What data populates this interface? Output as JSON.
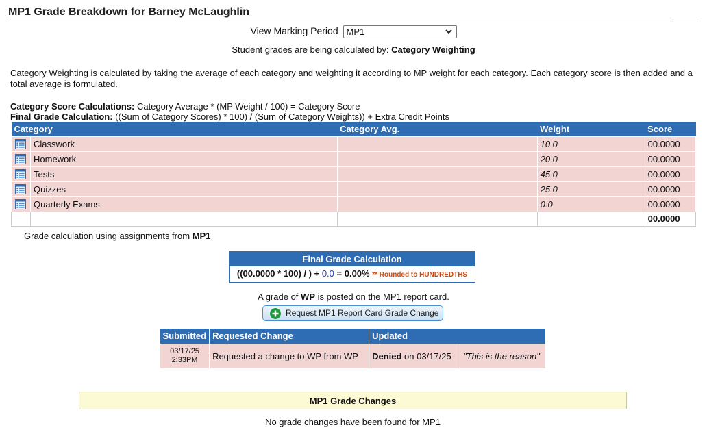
{
  "page": {
    "title": "MP1 Grade Breakdown for Barney McLaughlin"
  },
  "marking_period": {
    "label": "View Marking Period",
    "selected": "MP1"
  },
  "calc_method": {
    "prefix": "Student grades are being calculated by:",
    "method": "Category Weighting"
  },
  "description": "Category Weighting is calculated by taking the average of each category and weighting it according to MP weight for each category. Each category score is then added and a total average is formulated.",
  "formulas": {
    "category_label": "Category Score Calculations:",
    "category_text": "Category Average * (MP Weight / 100) = Category Score",
    "final_label": "Final Grade Calculation:",
    "final_text": "((Sum of Category Scores) * 100) / (Sum of Category Weights)) + Extra Credit Points"
  },
  "category_table": {
    "headers": {
      "category": "Category",
      "avg": "Category Avg.",
      "weight": "Weight",
      "score": "Score"
    },
    "rows": [
      {
        "category": "Classwork",
        "avg": "",
        "weight": "10.0",
        "score": "00.0000",
        "icon": "list-icon"
      },
      {
        "category": "Homework",
        "avg": "",
        "weight": "20.0",
        "score": "00.0000",
        "icon": "list-icon"
      },
      {
        "category": "Tests",
        "avg": "",
        "weight": "45.0",
        "score": "00.0000",
        "icon": "list-icon"
      },
      {
        "category": "Quizzes",
        "avg": "",
        "weight": "25.0",
        "score": "00.0000",
        "icon": "list-icon"
      },
      {
        "category": "Quarterly Exams",
        "avg": "",
        "weight": "0.0",
        "score": "00.0000",
        "icon": "list-icon"
      }
    ],
    "total_score": "00.0000"
  },
  "grade_using": {
    "prefix": "Grade calculation using assignments from",
    "mp": "MP1"
  },
  "final_calc": {
    "header": "Final Grade Calculation",
    "expr_start": "((00.0000 * 100) / ) + ",
    "extra": "0.0",
    "expr_end": " = 0.00%",
    "rounding": "** Rounded to HUNDREDTHS"
  },
  "posted": {
    "prefix": "A grade of",
    "grade": "WP",
    "suffix": "is posted on the MP1 report card."
  },
  "request_button": {
    "label": "Request MP1 Report Card Grade Change",
    "icon": "plus-circle-icon"
  },
  "change_table": {
    "headers": {
      "submitted": "Submitted",
      "requested": "Requested Change",
      "updated": "Updated"
    },
    "rows": [
      {
        "date": "03/17/25",
        "time": "2:33PM",
        "change": "Requested a change to WP from WP",
        "status": "Denied",
        "status_date": "on 03/17/25",
        "reason": "\"This is the reason\""
      }
    ]
  },
  "grade_changes": {
    "header": "MP1 Grade Changes",
    "empty_text": "No grade changes have been found for MP1"
  },
  "colors": {
    "header_blue": "#2e6db4",
    "row_pink": "#f2d4d3",
    "notice_yellow": "#fbfad4",
    "rounding_orange": "#d04a10"
  }
}
